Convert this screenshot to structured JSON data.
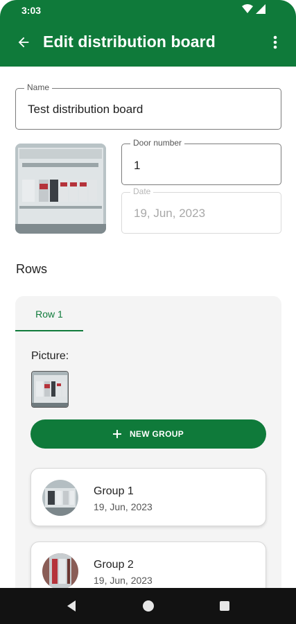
{
  "status_bar": {
    "time": "3:03"
  },
  "app_bar": {
    "title": "Edit distribution board"
  },
  "form": {
    "name": {
      "label": "Name",
      "value": "Test distribution board"
    },
    "door_number": {
      "label": "Door number",
      "value": "1"
    },
    "date": {
      "label": "Date",
      "value": "19, Jun, 2023"
    }
  },
  "rows_section": {
    "heading": "Rows",
    "tabs": [
      {
        "label": "Row 1",
        "selected": true
      }
    ],
    "picture_label": "Picture:",
    "new_group_label": "NEW GROUP",
    "groups": [
      {
        "name": "Group 1",
        "date": "19, Jun, 2023"
      },
      {
        "name": "Group 2",
        "date": "19, Jun, 2023"
      }
    ]
  },
  "icons": {
    "back": "arrow-back-icon",
    "more": "more-vert-icon",
    "add": "plus-icon",
    "wifi": "wifi-icon",
    "signal": "signal-icon",
    "nav_back": "triangle-back-icon",
    "nav_home": "circle-home-icon",
    "nav_recents": "square-recents-icon"
  },
  "colors": {
    "primary": "#0f7a3a",
    "surface": "#f4f4f4",
    "nav_bar": "#121212"
  }
}
